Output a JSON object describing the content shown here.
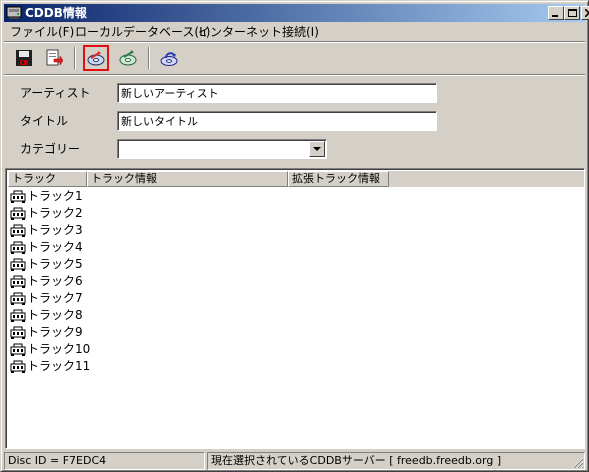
{
  "window": {
    "title": "CDDB情報",
    "icon": "cd-drive-icon"
  },
  "title_buttons": {
    "minimize": "minimize-icon",
    "maximize": "maximize-icon",
    "close": "close-icon"
  },
  "menu": {
    "items": [
      {
        "label": "ファイル(F)"
      },
      {
        "label": "ローカルデータベース(L)"
      },
      {
        "label": "インターネット接続(I)"
      }
    ]
  },
  "toolbar": {
    "buttons": [
      {
        "icon": "save-disk-icon"
      },
      {
        "icon": "export-icon"
      },
      {
        "icon": "cd-disc-icon"
      },
      {
        "icon": "cd-search-icon"
      },
      {
        "icon": "cd-upload-icon"
      }
    ],
    "active_index": 2
  },
  "form": {
    "artist_label": "アーティスト",
    "artist_value": "新しいアーティスト",
    "title_label": "タイトル",
    "title_value": "新しいタイトル",
    "category_label": "カテゴリー",
    "category_value": ""
  },
  "list": {
    "columns": [
      "トラック",
      "トラック情報",
      "拡張トラック情報"
    ],
    "rows": [
      {
        "track": "トラック1"
      },
      {
        "track": "トラック2"
      },
      {
        "track": "トラック3"
      },
      {
        "track": "トラック4"
      },
      {
        "track": "トラック5"
      },
      {
        "track": "トラック6"
      },
      {
        "track": "トラック7"
      },
      {
        "track": "トラック8"
      },
      {
        "track": "トラック9"
      },
      {
        "track": "トラック10"
      },
      {
        "track": "トラック11"
      }
    ],
    "row_icon": "audio-track-icon"
  },
  "status": {
    "disc_id": "Disc ID = F7EDC4",
    "server": "現在選択されているCDDBサーバー [ freedb.freedb.org ]"
  },
  "colors": {
    "title_start": "#0a246a",
    "title_end": "#a6caf0",
    "face": "#d4d0c8",
    "highlight_border": "#e01010"
  }
}
